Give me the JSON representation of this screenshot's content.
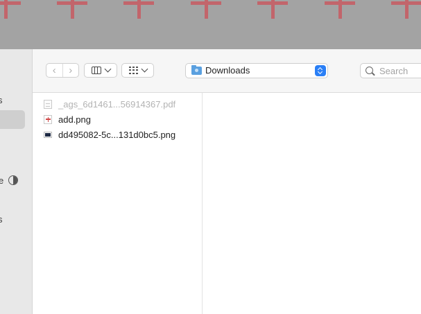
{
  "sidebar": {
    "items": [
      {
        "label": "s"
      },
      {
        "label": ""
      },
      {
        "label": "e"
      },
      {
        "label": "s"
      }
    ]
  },
  "toolbar": {
    "back_symbol": "‹",
    "forward_symbol": "›",
    "view_mode_icon": "columns-icon",
    "group_icon": "grid-icon",
    "location_label": "Downloads",
    "search_placeholder": "Search"
  },
  "files": [
    {
      "name": "_ags_6d1461...56914367.pdf",
      "icon": "pdf-file-icon",
      "dimmed": true
    },
    {
      "name": "add.png",
      "icon": "add-image-icon",
      "dimmed": false
    },
    {
      "name": "dd495082-5c...131d0bc5.png",
      "icon": "image-file-icon",
      "dimmed": false
    }
  ],
  "colors": {
    "accent": "#2a7ff6",
    "folder": "#5aa0e0",
    "wallpaper": "#a3a3a3",
    "wallpaper_cross": "#c2656b"
  }
}
